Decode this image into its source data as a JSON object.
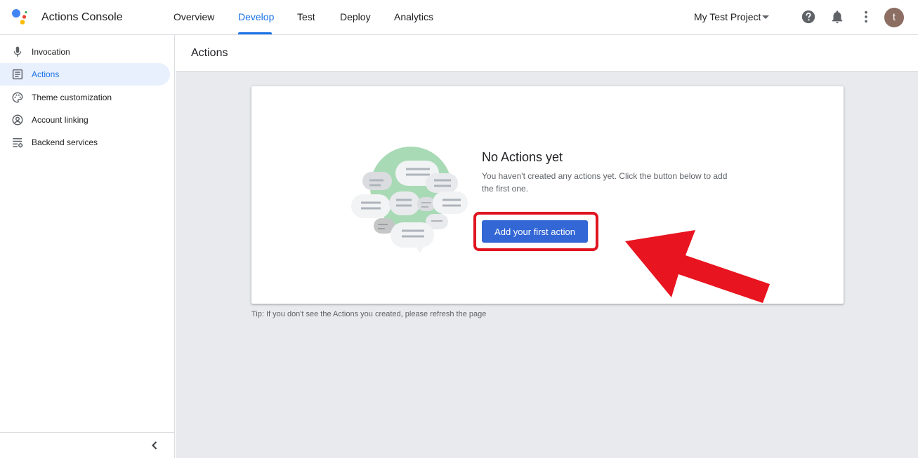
{
  "app": {
    "title": "Actions Console"
  },
  "nav": {
    "tabs": [
      {
        "label": "Overview"
      },
      {
        "label": "Develop"
      },
      {
        "label": "Test"
      },
      {
        "label": "Deploy"
      },
      {
        "label": "Analytics"
      }
    ],
    "active_tab": "Develop"
  },
  "header": {
    "project": "My Test Project",
    "avatar_letter": "t"
  },
  "sidebar": {
    "items": [
      {
        "label": "Invocation",
        "icon": "microphone-icon"
      },
      {
        "label": "Actions",
        "icon": "list-icon"
      },
      {
        "label": "Theme customization",
        "icon": "palette-icon"
      },
      {
        "label": "Account linking",
        "icon": "account-circle-icon"
      },
      {
        "label": "Backend services",
        "icon": "settings-list-icon"
      }
    ],
    "active_item": "Actions"
  },
  "main": {
    "page_title": "Actions",
    "empty_state": {
      "title": "No Actions yet",
      "description": "You haven't created any actions yet. Click the button below to add the first one.",
      "button_label": "Add your first action"
    },
    "tip": "Tip: If you don't see the Actions you created, please refresh the page"
  },
  "colors": {
    "accent": "#1a73e8",
    "button": "#3367d6",
    "annotation": "#e0141e",
    "background": "#e8eaed"
  }
}
